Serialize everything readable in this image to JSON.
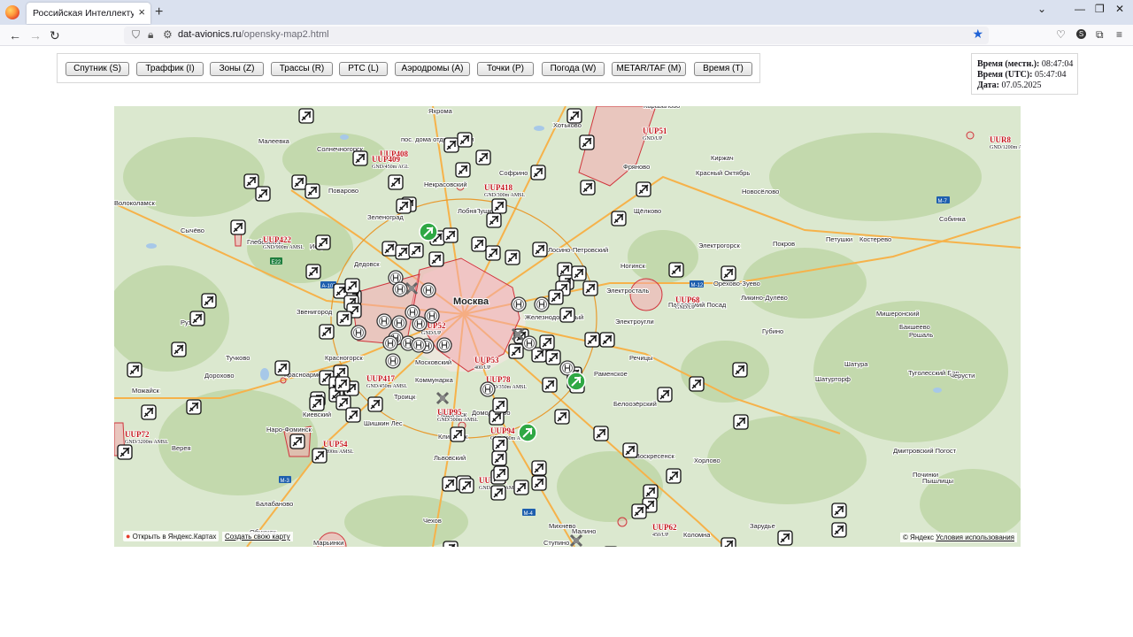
{
  "browser": {
    "tab_title": "Российская Интеллектуальная Си",
    "url_host": "dat-avionics.ru",
    "url_path": "/opensky-map2.html"
  },
  "layer_buttons": [
    "Спутник (S)",
    "Траффик (I)",
    "Зоны (Z)",
    "Трассы (R)",
    "РТС (L)",
    "Аэродромы (A)",
    "Точки (P)",
    "Погода (W)",
    "METAR/TAF (M)",
    "Время (T)"
  ],
  "time_panel": {
    "local_label": "Время (местн.):",
    "local_value": "08:47:04",
    "utc_label": "Время (UTC):",
    "utc_value": "05:47:04",
    "date_label": "Дата:",
    "date_value": "07.05.2025"
  },
  "map": {
    "colors": {
      "land": "#dbe8cf",
      "forest": "#c6dcb0",
      "city": "#f2eee6",
      "road": "#f6b24a",
      "zone_fill": "#f4a9b1",
      "zone_stroke": "#d0353c",
      "zone_label": "#c4161c",
      "airport_green": "#2fa844",
      "highway_badge": "#1e7e3e"
    },
    "places": [
      "Яхрома",
      "Хотьково",
      "Караваново",
      "Малеевка",
      "Солнечногорск",
      "пос. дома отдыха Горки",
      "Софрино",
      "Киржач",
      "Красный Октябрь",
      "Фряново",
      "Новосёлово",
      "Поварово",
      "Некрасовский",
      "Пушкино",
      "Лобня",
      "Зеленоград",
      "Щёлково",
      "Волоколамск",
      "Сычёво",
      "Глебовский",
      "Истра",
      "Собинка",
      "Петушки",
      "Костерево",
      "Покров",
      "Электрогорск",
      "Лосино-Петровский",
      "Дедовск",
      "Ногинск",
      "Электросталь",
      "Орехово-Зуево",
      "Павловский Посад",
      "Москва",
      "Звенигород",
      "Железнодорожный",
      "Ликино-Дулёво",
      "Руза",
      "Электроугли",
      "Губино",
      "Мишеронский",
      "Бакшеево",
      "Рошаль",
      "Тучково",
      "Красногорск",
      "Московский",
      "Раменское",
      "Речицы",
      "Шатура",
      "Дорохово",
      "Красноармейск",
      "Домодедово",
      "Коммунарка",
      "Троицк",
      "Белоозёрский",
      "Шатурторф",
      "Туголесский Бор",
      "Черусти",
      "Можайск",
      "Киевский",
      "Наро-Фоминск",
      "Шишкин Лес",
      "Подольск",
      "Климовск",
      "Львовский",
      "Чехов",
      "Михнево",
      "Воскресенск",
      "Хорлово",
      "Дмитровский Погост",
      "Верея",
      "Балабаново",
      "Обнинск",
      "Малино",
      "Ступино",
      "Коломна",
      "Зарудье",
      "Пышлицы",
      "Починки",
      "Марьинки"
    ],
    "zone_labels": [
      {
        "id": "UUP51",
        "sub": "GND/UP"
      },
      {
        "id": "UUR8",
        "sub": "GND/1200m A"
      },
      {
        "id": "UUP408",
        "sub": ""
      },
      {
        "id": "UUP409",
        "sub": "GND/450m AGL"
      },
      {
        "id": "UUP418",
        "sub": "GND/300m AMSL"
      },
      {
        "id": "UUP422",
        "sub": "GND/900m AMSL"
      },
      {
        "id": "UUP68",
        "sub": "GND/UP"
      },
      {
        "id": "UUP52",
        "sub": "GND/UP"
      },
      {
        "id": "UUP53",
        "sub": "400/UP"
      },
      {
        "id": "UUP78",
        "sub": "GND/350m AMSL"
      },
      {
        "id": "UUP417",
        "sub": "GND/450m AMSL"
      },
      {
        "id": "UUP95",
        "sub": "GND/300m AMSL"
      },
      {
        "id": "UUP94",
        "sub": "GND/300m AMSL"
      },
      {
        "id": "UUP72",
        "sub": "GND/3200m AMSL"
      },
      {
        "id": "UUP54",
        "sub": "1200m AMSL"
      },
      {
        "id": "UUP62",
        "sub": "450/UP"
      },
      {
        "id": "UUP411",
        "sub": "GND/300m AMSL"
      }
    ],
    "open_in_yandex": "Открыть в Яндекс.Картах",
    "create_map": "Создать свою карту",
    "copyright": "© Яндекс",
    "terms": "Условия использования"
  }
}
